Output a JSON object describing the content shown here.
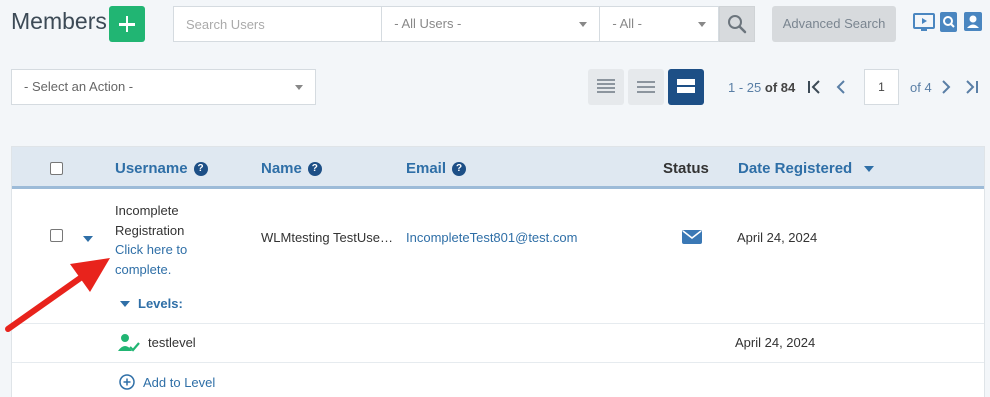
{
  "header": {
    "title": "Members",
    "search_placeholder": "Search Users",
    "users_filter": "- All Users -",
    "all_filter": "- All -",
    "advanced_search_label": "Advanced Search"
  },
  "toolbar": {
    "action_select": "- Select an Action -",
    "range_start": "1 - 25",
    "range_of": "of 84",
    "page_value": "1",
    "page_total": "of 4"
  },
  "table": {
    "headers": {
      "username": "Username",
      "name": "Name",
      "email": "Email",
      "status": "Status",
      "date_registered": "Date Registered"
    },
    "row": {
      "username_line1": "Incomplete",
      "username_line2": "Registration",
      "username_link1": "Click here to",
      "username_link2": "complete.",
      "name": "WLMtesting TestUse…",
      "email": "IncompleteTest801@test.com",
      "date": "April 24, 2024",
      "levels_label": "Levels:",
      "level_name": "testlevel",
      "level_date": "April 24, 2024",
      "add_level_label": "Add to Level"
    }
  },
  "colors": {
    "accent": "#2f6fa7",
    "add_button": "#21b573",
    "annotation_arrow": "#e8231c",
    "active_view": "#1d4f86"
  }
}
